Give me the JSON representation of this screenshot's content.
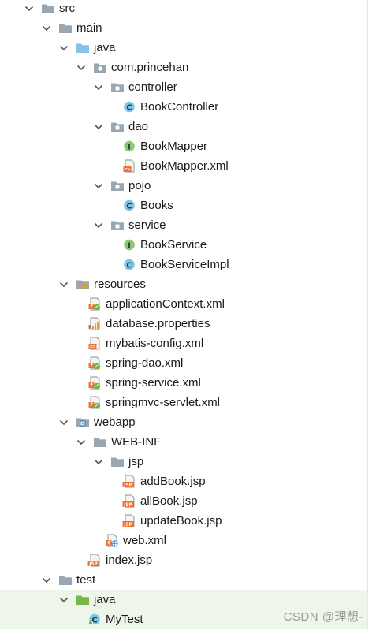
{
  "tree": {
    "rows": [
      {
        "label": "src",
        "icon": "folder",
        "expanded": true
      },
      {
        "label": "main",
        "icon": "folder",
        "expanded": true
      },
      {
        "label": "java",
        "icon": "source-folder",
        "expanded": true
      },
      {
        "label": "com.princehan",
        "icon": "package",
        "expanded": true
      },
      {
        "label": "controller",
        "icon": "package",
        "expanded": true
      },
      {
        "label": "BookController",
        "icon": "class"
      },
      {
        "label": "dao",
        "icon": "package",
        "expanded": true
      },
      {
        "label": "BookMapper",
        "icon": "interface"
      },
      {
        "label": "BookMapper.xml",
        "icon": "xml"
      },
      {
        "label": "pojo",
        "icon": "package",
        "expanded": true
      },
      {
        "label": "Books",
        "icon": "class"
      },
      {
        "label": "service",
        "icon": "package",
        "expanded": true
      },
      {
        "label": "BookService",
        "icon": "interface"
      },
      {
        "label": "BookServiceImpl",
        "icon": "class"
      },
      {
        "label": "resources",
        "icon": "resources-folder",
        "expanded": true
      },
      {
        "label": "applicationContext.xml",
        "icon": "spring-xml"
      },
      {
        "label": "database.properties",
        "icon": "properties"
      },
      {
        "label": "mybatis-config.xml",
        "icon": "xml"
      },
      {
        "label": "spring-dao.xml",
        "icon": "spring-xml"
      },
      {
        "label": "spring-service.xml",
        "icon": "spring-xml"
      },
      {
        "label": "springmvc-servlet.xml",
        "icon": "spring-xml"
      },
      {
        "label": "webapp",
        "icon": "web-folder",
        "expanded": true
      },
      {
        "label": "WEB-INF",
        "icon": "folder",
        "expanded": true
      },
      {
        "label": "jsp",
        "icon": "folder",
        "expanded": true
      },
      {
        "label": "addBook.jsp",
        "icon": "jsp"
      },
      {
        "label": "allBook.jsp",
        "icon": "jsp"
      },
      {
        "label": "updateBook.jsp",
        "icon": "jsp"
      },
      {
        "label": "web.xml",
        "icon": "web-xml"
      },
      {
        "label": "index.jsp",
        "icon": "jsp"
      },
      {
        "label": "test",
        "icon": "folder",
        "expanded": true
      },
      {
        "label": "java",
        "icon": "test-source-folder",
        "expanded": true,
        "highlighted": true
      },
      {
        "label": "MyTest",
        "icon": "test-class",
        "highlighted": true
      }
    ]
  },
  "icon_letters": {
    "class": "C",
    "interface": "I",
    "xml_badge": "<>",
    "jsp_badge": "JSP"
  },
  "colors": {
    "folder": "#9aa7b0",
    "source_folder": "#87c3e8",
    "test_folder": "#76b84a",
    "class_icon": "#7fc4e6",
    "interface_icon": "#8cc872",
    "xml_badge": "#e8743b",
    "spring_leaf": "#6db33f",
    "jsp_badge": "#e8743b",
    "highlight": "#eef6e9",
    "chevron": "#555555"
  },
  "watermark": "CSDN @理想-"
}
